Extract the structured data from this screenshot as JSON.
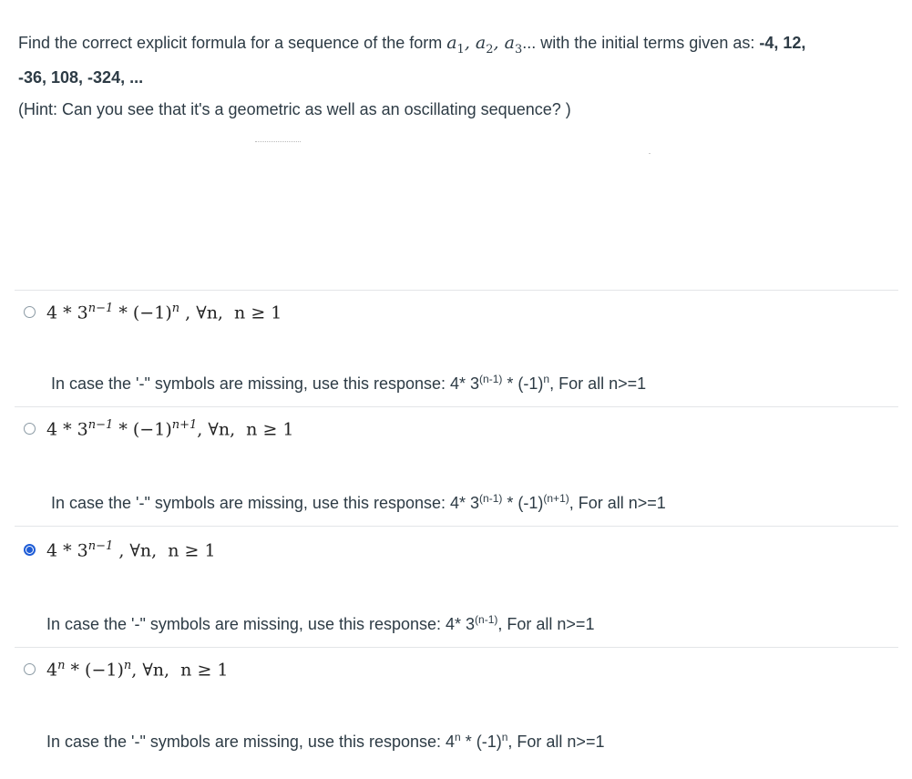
{
  "question": {
    "text_before": "Find the correct explicit formula for a sequence of the form ",
    "form_math": "a",
    "form_sep": ", ",
    "form_tail": "... with the initial terms given as: ",
    "terms_line1": "-4, 12,",
    "terms_line2": "-36, 108, -324, ...",
    "hint": "(Hint: Can you see that it's a geometric as well as an oscillating sequence? )"
  },
  "options": [
    {
      "formula": "4 * 3",
      "exp": "n−1",
      "tail": " * (−1)",
      "tail_exp": "n",
      "suffix": " , ∀n,  n ≥ 1",
      "checked": false,
      "response_prefix": "In case the '-\" symbols are missing, use this response:  4* 3",
      "response_exp": "(n-1)",
      "response_mid": " * (-1)",
      "response_exp2": "n",
      "response_suffix": ", For all n>=1"
    },
    {
      "formula": "4 * 3",
      "exp": "n−1",
      "tail": " * (−1)",
      "tail_exp": "n+1",
      "suffix": ", ∀n,  n ≥ 1",
      "checked": false,
      "response_prefix": "In case the '-\" symbols are missing, use this response:  4* 3",
      "response_exp": "(n-1)",
      "response_mid": " * (-1)",
      "response_exp2": "(n+1)",
      "response_suffix": ", For all n>=1"
    },
    {
      "formula": "4 * 3",
      "exp": "n−1",
      "tail": "",
      "tail_exp": "",
      "suffix": " , ∀n,  n ≥ 1",
      "checked": true,
      "response_prefix": "In case the '-\" symbols are missing, use this response:  4* 3",
      "response_exp": "(n-1)",
      "response_mid": "",
      "response_exp2": "",
      "response_suffix": ", For all n>=1"
    },
    {
      "formula": "4",
      "exp": "n",
      "tail": " * (−1)",
      "tail_exp": "n",
      "suffix": ", ∀n,  n ≥ 1",
      "checked": false,
      "response_prefix": "In case the '-\" symbols are missing, use this response:  4",
      "response_exp": "n",
      "response_mid": " * (-1)",
      "response_exp2": "n",
      "response_suffix": ", For all n>=1"
    }
  ]
}
